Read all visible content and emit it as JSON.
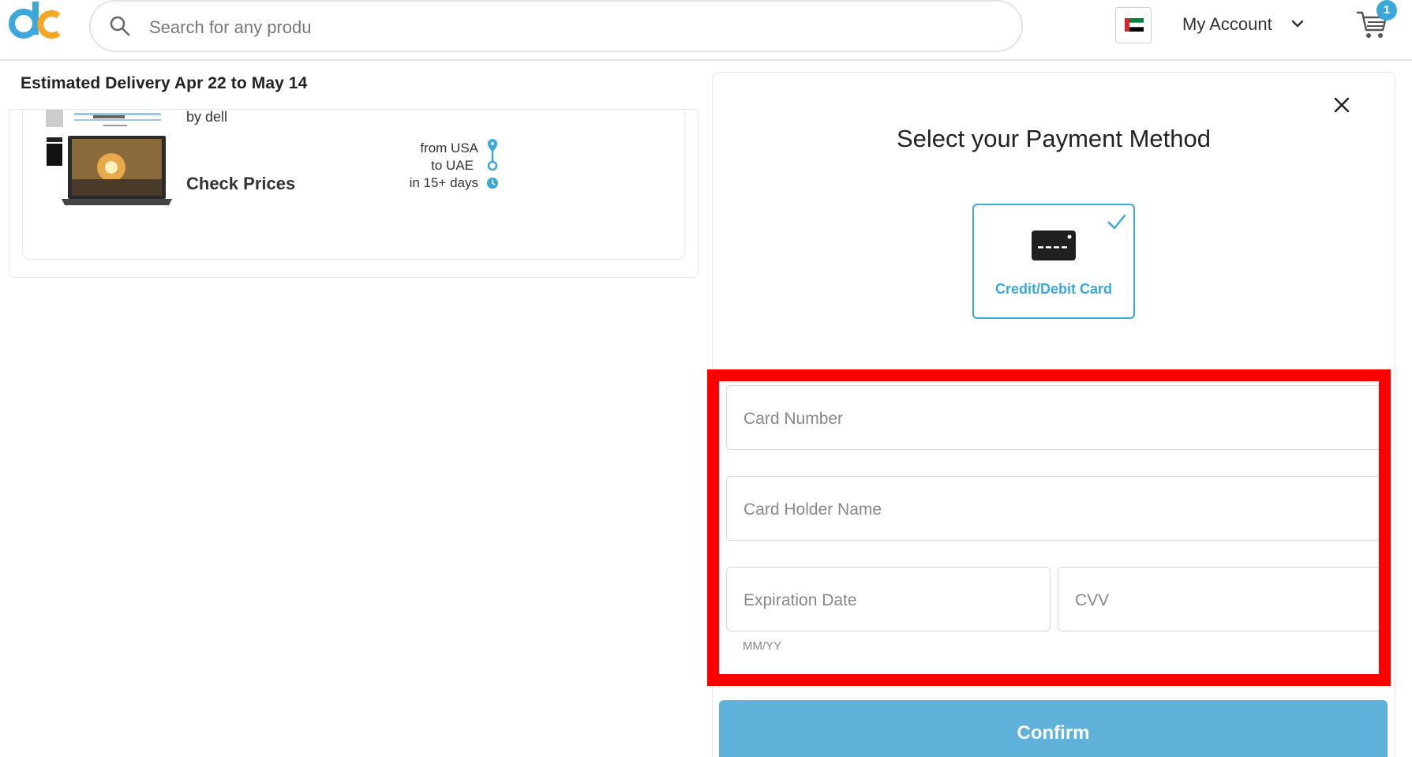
{
  "header": {
    "search_placeholder": "Search for any produ",
    "account_label": "My Account",
    "cart_count": "1",
    "colors": {
      "brand_blue": "#3ba7db",
      "brand_orange": "#f5a623"
    },
    "icons": [
      "logo",
      "search-icon",
      "uae-flag-icon",
      "chevron-down-icon",
      "cart-icon"
    ]
  },
  "left": {
    "estimated_delivery": "Estimated Delivery Apr 22 to May 14",
    "product": {
      "by": "by dell",
      "cta": "Check Prices",
      "route_from": "from USA",
      "route_to": "to UAE",
      "route_days": "in 15+ days"
    }
  },
  "payment": {
    "title": "Select your Payment Method",
    "method_label": "Credit/Debit Card",
    "fields": {
      "card_number": "Card Number",
      "card_holder": "Card Holder Name",
      "expiration": "Expiration Date",
      "cvv": "CVV",
      "expiration_hint": "MM/YY"
    },
    "confirm_label": "Confirm",
    "colors": {
      "accent": "#3ba7db",
      "confirm_bg": "#5fb1da",
      "highlight": "#ff0000"
    }
  }
}
